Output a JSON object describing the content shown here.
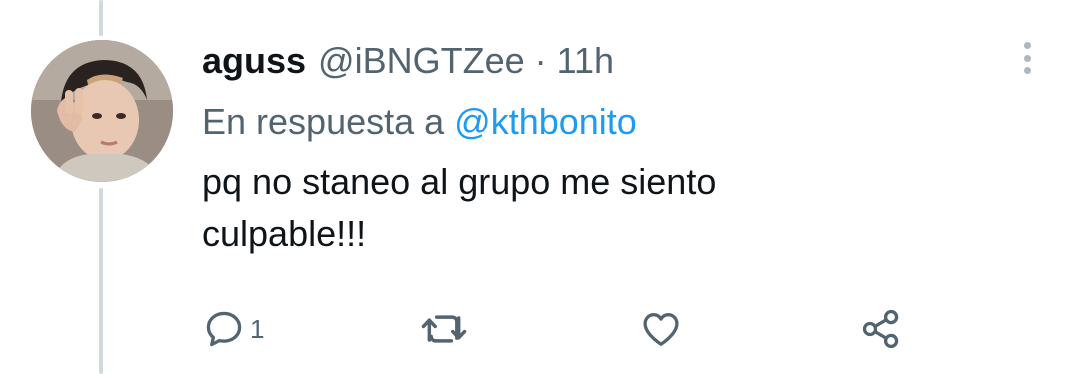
{
  "tweet": {
    "display_name": "aguss",
    "handle": "@iBNGTZee",
    "separator": "·",
    "time": "11h",
    "reply_prefix": "En respuesta a",
    "reply_target": "@kthbonito",
    "text_line1": "pq no staneo al grupo me siento",
    "text_line2": "culpable!!!",
    "avatar_icon": "user-avatar-photo"
  },
  "actions": {
    "reply_icon": "comment-icon",
    "reply_count": "1",
    "retweet_icon": "retweet-icon",
    "like_icon": "heart-icon",
    "share_icon": "share-icon",
    "more_icon": "more-vertical-icon"
  },
  "colors": {
    "text": "#0f1419",
    "secondary": "#536471",
    "link": "#1d9bf0",
    "thread_line": "#cfd9de"
  }
}
